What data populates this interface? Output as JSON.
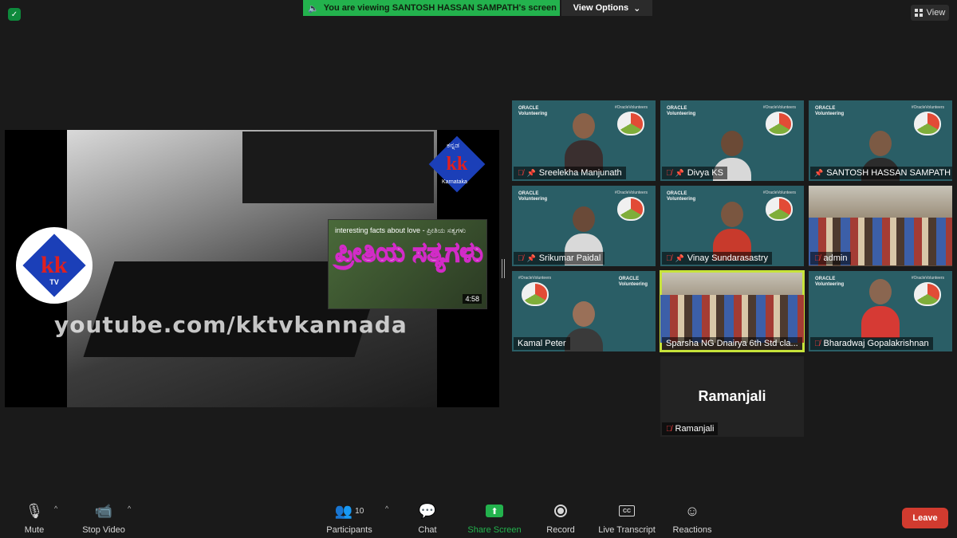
{
  "top": {
    "banner": "You are viewing SANTOSH HASSAN SAMPATH's screen",
    "view_options": "View Options",
    "view": "View"
  },
  "shared": {
    "watermark": "youtube.com/kktvkannada",
    "logo_left_text": "kk",
    "logo_left_sub": "TV",
    "logo_right_text": "kk",
    "logo_right_top": "ಕನ್ನಡ",
    "logo_right_bottom": "Karnataka",
    "thumb_title": "interesting facts about love - ಪ್ರೀತಿಯ ಸತ್ಯಗಳು",
    "thumb_kannada": "ಪ್ರೀತಿಯ ಸತ್ಯಗಳು",
    "thumb_duration": "4:58"
  },
  "tiles": {
    "brand_line1": "ORACLE",
    "brand_line2": "Volunteering",
    "tag": "#OracleVolunteers",
    "participants": [
      {
        "name": "Sreelekha Manjunath"
      },
      {
        "name": "Divya KS"
      },
      {
        "name": "SANTOSH HASSAN SAMPATH"
      },
      {
        "name": "Srikumar Paidal"
      },
      {
        "name": "Vinay Sundarasastry"
      },
      {
        "name": "admin"
      },
      {
        "name": "Kamal Peter"
      },
      {
        "name": "Sparsha NG Dnairya 6th  Std cla..."
      },
      {
        "name": "Bharadwaj Gopalakrishnan"
      },
      {
        "name": "Ramanjali"
      }
    ],
    "ramanjali_big": "Ramanjali"
  },
  "toolbar": {
    "mute": "Mute",
    "stop_video": "Stop Video",
    "participants": "Participants",
    "participants_count": "10",
    "chat": "Chat",
    "share_screen": "Share Screen",
    "record": "Record",
    "live_transcript": "Live Transcript",
    "reactions": "Reactions",
    "leave": "Leave",
    "cc": "CC"
  },
  "colors": {
    "share_green": "#23b24d",
    "leave_red": "#d13b2f",
    "tile_teal": "#2a5e66",
    "active_speaker": "#c7e33a"
  }
}
